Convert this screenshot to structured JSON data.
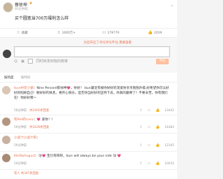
{
  "post": {
    "author": "蔡徐坤",
    "vip_badge": "♛",
    "time_source": "60分钟前",
    "text": "买个圆宽当700万福利怎么样",
    "actions": [
      {
        "icon": "star-icon",
        "label": "收藏"
      },
      {
        "icon": "share-icon",
        "label": "1000万+"
      },
      {
        "icon": "comment-icon",
        "label": "179779"
      },
      {
        "icon": "like-icon",
        "label": "2019"
      }
    ]
  },
  "comment_box": {
    "hint_prefix": "为您开启了评论评论平台,",
    "hint_link": "我要查看",
    "placeholder": "",
    "tools": [
      "☺",
      "▣"
    ],
    "also_post_label": "同时转发到我的微博",
    "send_label": "评论"
  },
  "tabs": [
    {
      "label": "按热度",
      "active": true
    },
    {
      "label": "按时间",
      "active": false
    }
  ],
  "comments": [
    {
      "name": "ikun村花小鹅",
      "text": "：Nine Percent蔡徐坤💗，你好！ ikun最近有被你好好的宠爱你亲亲抱抱升级,好希望你可以好好的照顾自己！要好好的休息，要开心快乐，是否你当好好的坚持下去，你真的最棒了！不要辛苦，你有我们在！你好好哦～",
      "time": "58分钟前",
      "replies": "共1000条回复",
      "likes": "13442"
    },
    {
      "name": "有Rell的coco",
      "text": "：💗 爱你！！",
      "time": "59分钟前",
      "replies": "共1639条回复",
      "likes": "14482"
    },
    {
      "name": "小卤汁小卤汁呀",
      "text": "：",
      "time": "59分钟前",
      "replies": "",
      "likes": "12345"
    },
    {
      "name": "KikiNaAugust",
      "text": "：😘💗 宝贝哥哥呀，ikun will always be your side 😘 💗",
      "time": "59分钟前",
      "replies": "",
      "likes": "10032"
    },
    {
      "name": "",
      "text": "",
      "time": "",
      "replies": "等人 共397条回复",
      "likes": ""
    }
  ]
}
